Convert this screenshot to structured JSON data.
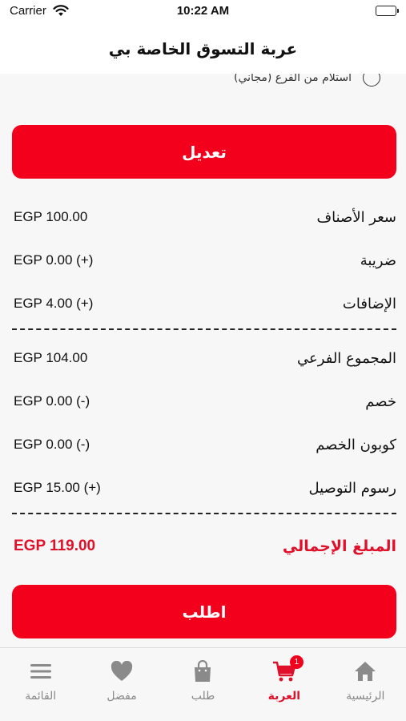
{
  "status_bar": {
    "carrier": "Carrier",
    "time": "10:22 AM"
  },
  "header": {
    "title": "عربة التسوق الخاصة بي"
  },
  "pickup_option": {
    "label": "استلام من الفرع  (مجاني)",
    "selected": false
  },
  "edit_button": {
    "label": "تعديل"
  },
  "summary": {
    "items_price": {
      "label": "سعر الأصناف",
      "value": "EGP 100.00"
    },
    "tax": {
      "label": "ضريبة",
      "value": "EGP 0.00 (+)"
    },
    "addons": {
      "label": "الإضافات",
      "value": "EGP 4.00 (+)"
    },
    "subtotal": {
      "label": "المجموع الفرعي",
      "value": "EGP 104.00"
    },
    "discount": {
      "label": "خصم",
      "value": "EGP 0.00 (-)"
    },
    "coupon_discount": {
      "label": "كوبون الخصم",
      "value": "EGP 0.00 (-)"
    },
    "delivery_fee": {
      "label": "رسوم التوصيل",
      "value": "EGP 15.00 (+)"
    },
    "total": {
      "label": "المبلغ الإجمالي",
      "value": "EGP 119.00"
    }
  },
  "order_button": {
    "label": "اطلب"
  },
  "tab_bar": {
    "menu": {
      "label": "القائمة",
      "icon": "menu-icon"
    },
    "favorites": {
      "label": "مفضل",
      "icon": "heart-icon"
    },
    "orders": {
      "label": "طلب",
      "icon": "shopping-bag-icon"
    },
    "cart": {
      "label": "العربة",
      "icon": "cart-icon",
      "badge": "1",
      "active": true
    },
    "home": {
      "label": "الرئيسية",
      "icon": "home-icon"
    }
  },
  "colors": {
    "accent": "#f2001c",
    "total_text": "#e0102a",
    "inactive_tab": "#8a8a8a"
  }
}
